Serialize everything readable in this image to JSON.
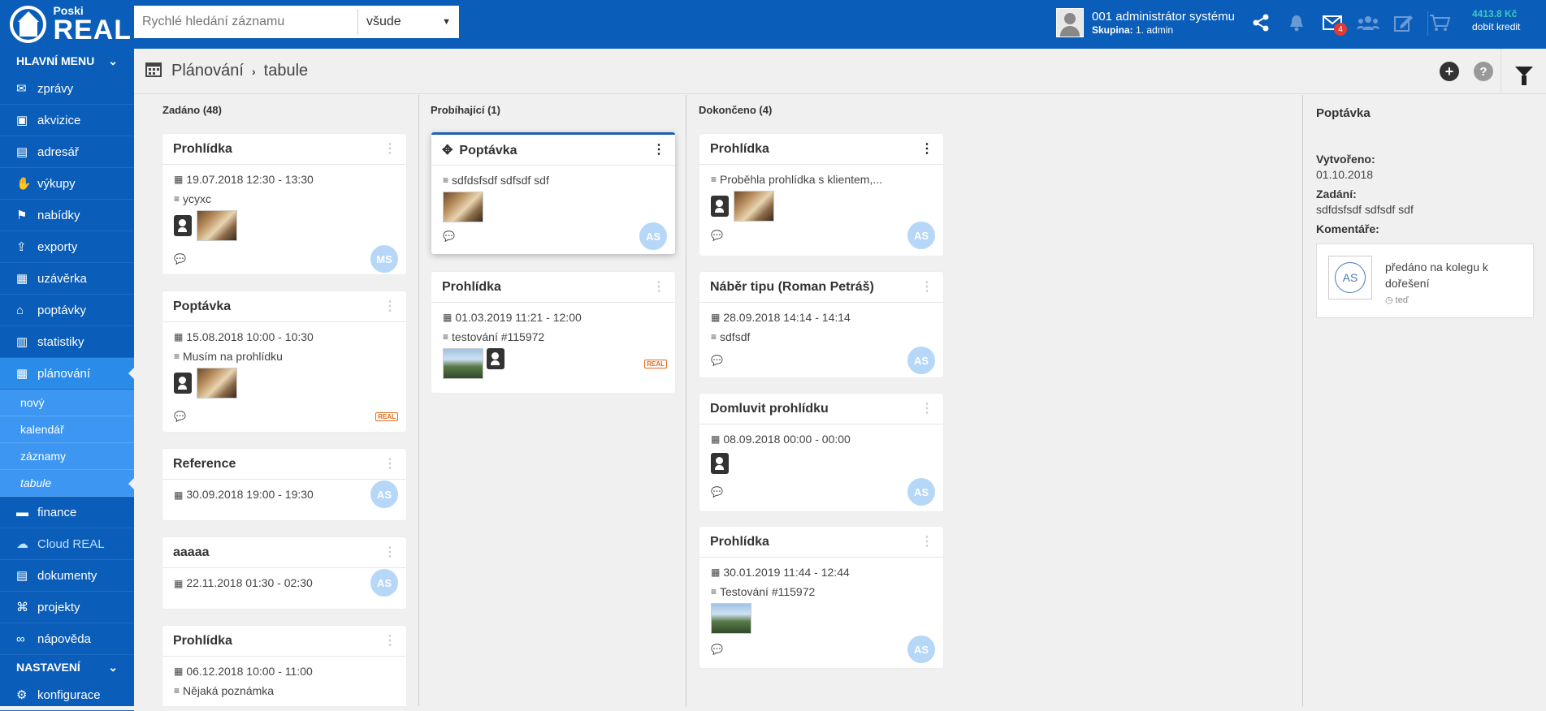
{
  "app": {
    "brand_small": "Poski",
    "brand_big": "REAL"
  },
  "search": {
    "placeholder": "Rychlé hledání záznamu",
    "scope": "všude"
  },
  "user": {
    "name": "001 administrátor systému",
    "group_label": "Skupina:",
    "group_value": "1. admin"
  },
  "mail_badge": "4",
  "credit": {
    "amount": "4413.8 Kč",
    "label": "dobít kredit"
  },
  "sidebar": {
    "main_header": "HLAVNÍ MENU",
    "items": [
      {
        "label": "zprávy",
        "icon": "inbox-icon",
        "glyph": "✉"
      },
      {
        "label": "akvizice",
        "icon": "id-card-icon",
        "glyph": "▣"
      },
      {
        "label": "adresář",
        "icon": "address-book-icon",
        "glyph": "▤"
      },
      {
        "label": "výkupy",
        "icon": "hand-icon",
        "glyph": "✋"
      },
      {
        "label": "nabídky",
        "icon": "sign-icon",
        "glyph": "⚑"
      },
      {
        "label": "exporty",
        "icon": "export-icon",
        "glyph": "⇪"
      },
      {
        "label": "uzávěrka",
        "icon": "archive-icon",
        "glyph": "▦"
      },
      {
        "label": "poptávky",
        "icon": "basket-icon",
        "glyph": "⌂"
      },
      {
        "label": "statistiky",
        "icon": "bar-chart-icon",
        "glyph": "▥"
      },
      {
        "label": "plánování",
        "icon": "calendar-icon",
        "glyph": "▦"
      }
    ],
    "sub_items": [
      "nový",
      "kalendář",
      "záznamy",
      "tabule"
    ],
    "items_after": [
      {
        "label": "finance",
        "icon": "money-icon",
        "glyph": "▬"
      },
      {
        "label": "Cloud REAL",
        "icon": "users-icon",
        "glyph": "☁"
      },
      {
        "label": "dokumenty",
        "icon": "book-icon",
        "glyph": "▤"
      },
      {
        "label": "projekty",
        "icon": "sitemap-icon",
        "glyph": "⌘"
      },
      {
        "label": "nápověda",
        "icon": "link-icon",
        "glyph": "∞"
      }
    ],
    "settings_header": "NASTAVENÍ",
    "settings_items": [
      {
        "label": "konfigurace",
        "icon": "gear-icon",
        "glyph": "⚙"
      }
    ]
  },
  "page": {
    "section": "Plánování",
    "subsection": "tabule"
  },
  "columns": [
    {
      "title": "Zadáno (48)"
    },
    {
      "title": "Probíhající (1)"
    },
    {
      "title": "Dokončeno (4)"
    }
  ],
  "cards": {
    "c1": {
      "title": "Prohlídka",
      "date": "19.07.2018 12:30 - 13:30",
      "note": "ycyxc",
      "initials": "MS"
    },
    "c2": {
      "title": "Poptávka",
      "date": "15.08.2018 10:00 - 10:30",
      "note": "Musím na prohlídku"
    },
    "c3": {
      "title": "Reference",
      "date": "30.09.2018 19:00 - 19:30",
      "initials": "AS"
    },
    "c4": {
      "title": "aaaaa",
      "date": "22.11.2018 01:30 - 02:30",
      "initials": "AS"
    },
    "c5": {
      "title": "Prohlídka",
      "date": "06.12.2018 10:00 - 11:00",
      "note": "Nějaká poznámka"
    },
    "p1": {
      "title": "Poptávka",
      "note": "sdfdsfsdf sdfsdf sdf",
      "initials": "AS"
    },
    "p2": {
      "title": "Prohlídka",
      "date": "01.03.2019 11:21 - 12:00",
      "note": "testování #115972"
    },
    "d1": {
      "title": "Prohlídka",
      "note": "Proběhla prohlídka s klientem,...",
      "initials": "AS"
    },
    "d2": {
      "title": "Náběr tipu (Roman Petráš)",
      "date": "28.09.2018 14:14 - 14:14",
      "note": "sdfsdf",
      "initials": "AS"
    },
    "d3": {
      "title": "Domluvit prohlídku",
      "date": "08.09.2018 00:00 - 00:00",
      "initials": "AS"
    },
    "d4": {
      "title": "Prohlídka",
      "date": "30.01.2019 11:44 - 12:44",
      "note": "Testování #115972",
      "initials": "AS"
    }
  },
  "detail": {
    "title": "Poptávka",
    "created_label": "Vytvořeno:",
    "created_value": "01.10.2018",
    "task_label": "Zadání:",
    "task_value": "sdfdsfsdf sdfsdf sdf",
    "comments_label": "Komentáře:",
    "comment": {
      "initials": "AS",
      "text": "předáno na kolegu k dořešení",
      "time": "teď"
    }
  }
}
